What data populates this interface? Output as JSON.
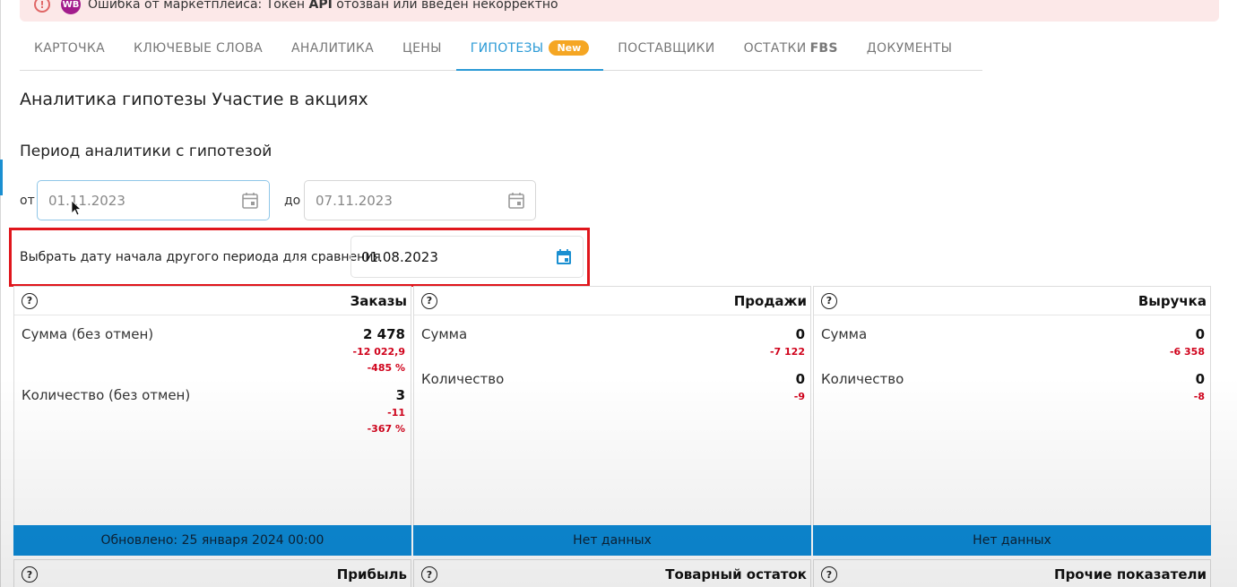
{
  "alert": {
    "text_prefix": "Ошибка от маркетплейса: Токен ",
    "text_bold": "API",
    "text_suffix": " отозван или введен некорректно",
    "marketplace_badge": "WB"
  },
  "tabs": [
    {
      "label": "КАРТОЧКА"
    },
    {
      "label": "КЛЮЧЕВЫЕ СЛОВА"
    },
    {
      "label": "АНАЛИТИКА"
    },
    {
      "label": "ЦЕНЫ"
    },
    {
      "label": "ГИПОТЕЗЫ",
      "badge": "New",
      "active": true
    },
    {
      "label": "ПОСТАВЩИКИ"
    },
    {
      "label": "ОСТАТКИ",
      "suffix": "FBS"
    },
    {
      "label": "ДОКУМЕНТЫ"
    }
  ],
  "page_title": "Аналитика гипотезы Участие в акциях",
  "period_title": "Период аналитики с гипотезой",
  "period": {
    "from_label": "от",
    "from_value": "01.11.2023",
    "to_label": "до",
    "to_value": "07.11.2023"
  },
  "compare": {
    "label": "Выбрать дату начала другого периода для сравнения",
    "value": "01.08.2023"
  },
  "cards": [
    {
      "title": "Заказы",
      "rows": [
        {
          "label": "Сумма (без отмен)",
          "value": "2 478",
          "deltas": [
            "-12 022,9",
            "-485 %"
          ]
        },
        {
          "label": "Количество (без отмен)",
          "value": "3",
          "deltas": [
            "-11",
            "-367 %"
          ]
        }
      ],
      "footer": "Обновлено: 25 января 2024 00:00"
    },
    {
      "title": "Продажи",
      "rows": [
        {
          "label": "Сумма",
          "value": "0",
          "deltas": [
            "-7 122"
          ]
        },
        {
          "label": "Количество",
          "value": "0",
          "deltas": [
            "-9"
          ]
        }
      ],
      "footer": "Нет данных"
    },
    {
      "title": "Выручка",
      "rows": [
        {
          "label": "Сумма",
          "value": "0",
          "deltas": [
            "-6 358"
          ]
        },
        {
          "label": "Количество",
          "value": "0",
          "deltas": [
            "-8"
          ]
        }
      ],
      "footer": "Нет данных"
    }
  ],
  "cards_row2": [
    {
      "title": "Прибыль"
    },
    {
      "title": "Товарный остаток"
    },
    {
      "title": "Прочие показатели"
    }
  ],
  "colors": {
    "accent": "#2a9ad6",
    "footer_bar": "#0d8ad6",
    "negative": "#d0021b",
    "highlight_border": "#e0161c",
    "badge": "#f5a623"
  },
  "icons": {
    "help": "question-circle-icon",
    "calendar": "calendar-icon",
    "warning": "warning-icon"
  }
}
